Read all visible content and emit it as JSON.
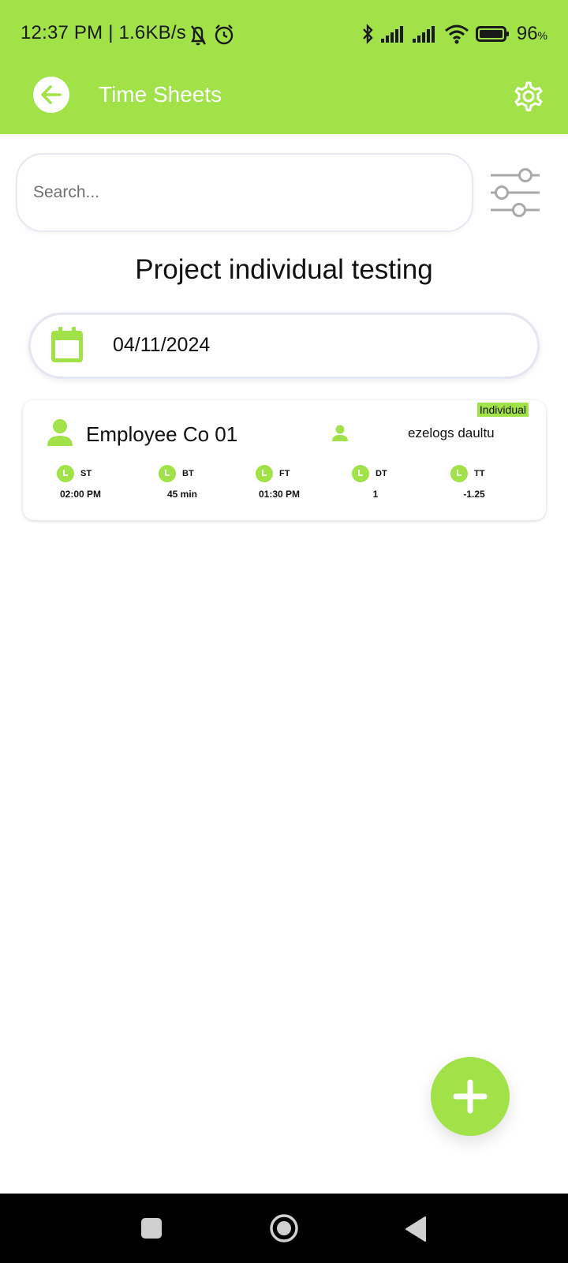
{
  "status_bar": {
    "time": "12:37 PM | 1.6KB/s",
    "battery_percent": "96",
    "battery_suffix": "%",
    "icons": [
      "bell-muted-icon",
      "alarm-icon",
      "bluetooth-icon",
      "signal-icon",
      "signal-icon",
      "wifi-icon",
      "battery-icon"
    ]
  },
  "app_bar": {
    "title": "Time Sheets",
    "back_icon": "arrow-left-icon",
    "settings_icon": "gear-icon",
    "background_color": "#a0e248"
  },
  "search": {
    "placeholder": "Search...",
    "value": "",
    "filter_icon": "sliders-icon"
  },
  "project": {
    "title": "Project individual testing"
  },
  "date_picker": {
    "value": "04/11/2024",
    "icon": "calendar-icon"
  },
  "entries": [
    {
      "badge": "Individual",
      "employee": "Employee Co 01",
      "user": "ezelogs daultu",
      "stats": [
        {
          "label": "ST",
          "value": "02:00 PM"
        },
        {
          "label": "BT",
          "value": "45 min"
        },
        {
          "label": "FT",
          "value": "01:30 PM"
        },
        {
          "label": "DT",
          "value": "1"
        },
        {
          "label": "TT",
          "value": "-1.25"
        }
      ]
    }
  ],
  "fab": {
    "icon": "plus-icon"
  },
  "nav_bar": {
    "buttons": [
      "recents-icon",
      "home-icon",
      "back-triangle-icon"
    ]
  },
  "colors": {
    "accent": "#a0e248",
    "white": "#ffffff",
    "text": "#111111"
  }
}
